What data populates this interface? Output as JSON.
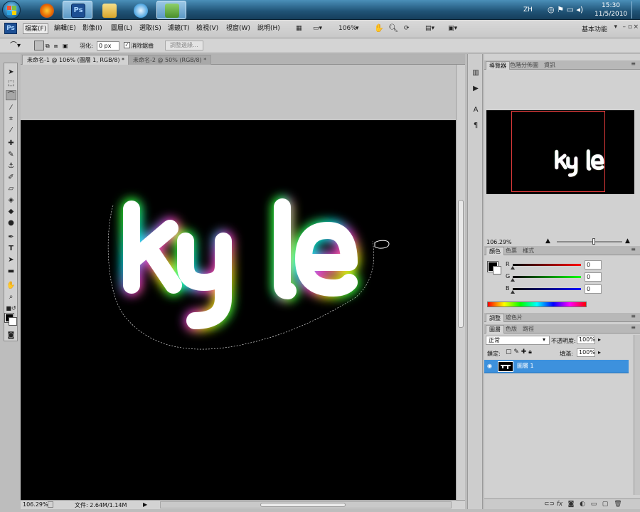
{
  "taskbar": {
    "apps": [
      {
        "name": "firefox",
        "color": "#e66000"
      },
      {
        "name": "photoshop",
        "color": "#1d4f93",
        "label": "Ps",
        "active": true
      },
      {
        "name": "explorer",
        "color": "#e5c35a"
      },
      {
        "name": "itunes",
        "color": "#4aa3df"
      },
      {
        "name": "messenger",
        "color": "#5fa23c"
      }
    ],
    "tray": {
      "lang": "ZH",
      "time": "15:30",
      "date": "11/5/2010"
    }
  },
  "menubar": {
    "items": [
      "檔案(F)",
      "編輯(E)",
      "影像(I)",
      "圖層(L)",
      "選取(S)",
      "濾鏡(T)",
      "檢視(V)",
      "視窗(W)",
      "說明(H)"
    ],
    "zoom": "106%",
    "workspace": "基本功能"
  },
  "options": {
    "feather_label": "羽化:",
    "feather_value": "0 px",
    "antialias_label": "消除鋸齒",
    "refine_edge": "調整邊緣..."
  },
  "document": {
    "tabs": [
      "未命名-1 @ 106% (圖層 1, RGB/8) *",
      "未命名-2 @ 50% (RGB/8) *"
    ],
    "canvas_text": "kyle",
    "status_zoom": "106.29%",
    "status_doc": "文件: 2.64M/1.14M"
  },
  "navigator": {
    "tabs": [
      "導覽器",
      "色階分佈圖",
      "資訊"
    ],
    "zoom": "106.29%",
    "preview_text": "kyle"
  },
  "color_panel": {
    "tabs": [
      "顏色",
      "色票",
      "樣式"
    ],
    "channels": [
      {
        "label": "R",
        "value": "0",
        "gradient": "linear-gradient(to right,#000,#ff0000)"
      },
      {
        "label": "G",
        "value": "0",
        "gradient": "linear-gradient(to right,#000,#00ff00)"
      },
      {
        "label": "B",
        "value": "0",
        "gradient": "linear-gradient(to right,#000,#0000ff)"
      }
    ]
  },
  "adjust_panel": {
    "tabs": [
      "調整",
      "遮色片"
    ]
  },
  "layers_panel": {
    "tabs": [
      "圖層",
      "色版",
      "路徑"
    ],
    "blend_mode": "正常",
    "opacity_label": "不透明度:",
    "opacity_value": "100%",
    "lock_label": "鎖定:",
    "fill_label": "填滿:",
    "fill_value": "100%",
    "layer_name": "圖層 1"
  },
  "colors": {
    "selection": "#3d91dd",
    "glow": [
      "#00e5ff",
      "#ff2bd6",
      "#ffe600",
      "#32ff3a"
    ]
  }
}
